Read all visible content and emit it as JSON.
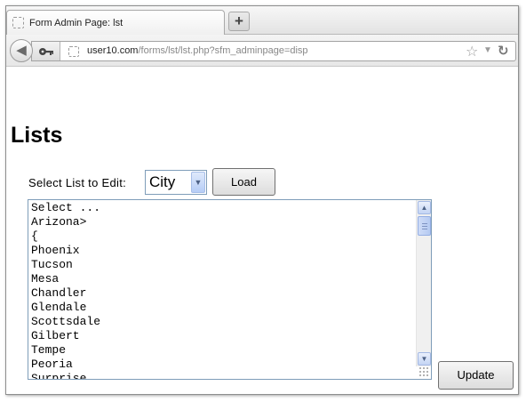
{
  "browser": {
    "tab_title": "Form Admin Page: lst",
    "new_tab_symbol": "+",
    "url_domain": "user10.com",
    "url_path": "/forms/lst/lst.php?sfm_adminpage=disp",
    "icons": {
      "back": "back-arrow-icon",
      "identity": "key-icon",
      "bookmark": "star-icon",
      "reload": "reload-icon"
    }
  },
  "page": {
    "title": "Lists",
    "select_label": "Select List to Edit:",
    "selected_list": "City",
    "load_label": "Load",
    "update_label": "Update",
    "list_lines": [
      "Select ...",
      "Arizona>",
      "{",
      "Phoenix",
      "Tucson",
      "Mesa",
      "Chandler",
      "Glendale",
      "Scottsdale",
      "Gilbert",
      "Tempe",
      "Peoria",
      "Surprise"
    ]
  }
}
